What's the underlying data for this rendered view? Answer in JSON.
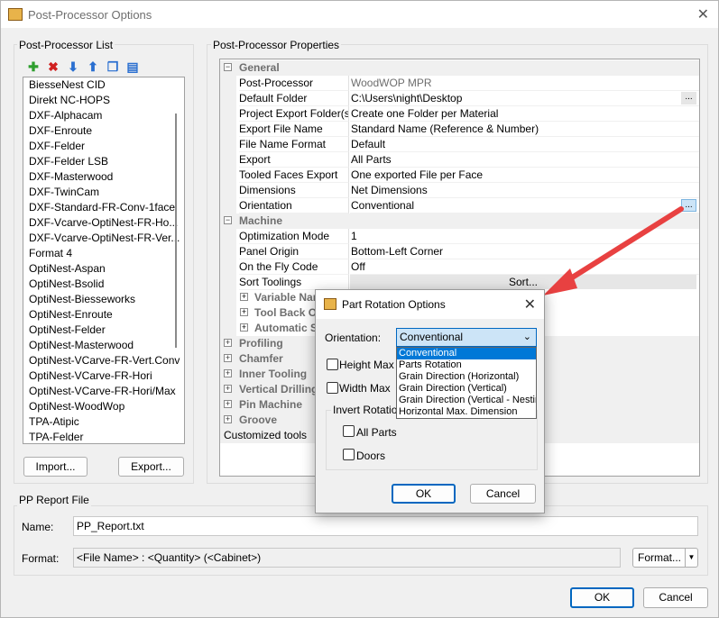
{
  "window": {
    "title": "Post-Processor Options",
    "close_glyph": "✕"
  },
  "left_panel": {
    "group_label": "Post-Processor List",
    "toolbar": [
      {
        "name": "add-icon",
        "glyph": "✚",
        "color": "#2e9e2e"
      },
      {
        "name": "delete-icon",
        "glyph": "✖",
        "color": "#d02020"
      },
      {
        "name": "move-down-icon",
        "glyph": "⬇",
        "color": "#2a6fd0"
      },
      {
        "name": "move-up-icon",
        "glyph": "⬆",
        "color": "#2a6fd0"
      },
      {
        "name": "copy-icon",
        "glyph": "❐",
        "color": "#2a6fd0"
      },
      {
        "name": "rename-icon",
        "glyph": "▤",
        "color": "#2a6fd0"
      }
    ],
    "items": [
      "BiesseNest CID",
      "Direkt NC-HOPS",
      "DXF-Alphacam",
      "DXF-Enroute",
      "DXF-Felder",
      "DXF-Felder LSB",
      "DXF-Masterwood",
      "DXF-TwinCam",
      "DXF-Standard-FR-Conv-1face",
      "DXF-Vcarve-OptiNest-FR-Ho...",
      "DXF-Vcarve-OptiNest-FR-Ver...",
      "Format 4",
      "OptiNest-Aspan",
      "OptiNest-Bsolid",
      "OptiNest-Biesseworks",
      "OptiNest-Enroute",
      "OptiNest-Felder",
      "OptiNest-Masterwood",
      "OptiNest-VCarve-FR-Vert.Conv",
      "OptiNest-VCarve-FR-Hori",
      "OptiNest-VCarve-FR-Hori/Max",
      "OptiNest-WoodWop",
      "TPA-Atipic",
      "TPA-Felder"
    ],
    "import_label": "Import...",
    "export_label": "Export..."
  },
  "properties": {
    "group_label": "Post-Processor Properties",
    "general": {
      "label": "General",
      "rows": [
        {
          "name": "Post-Processor",
          "value": "WoodWOP MPR",
          "gray": true
        },
        {
          "name": "Default Folder",
          "value": "C:\\Users\\night\\Desktop",
          "ellipsis": "..."
        },
        {
          "name": "Project Export Folder(s)",
          "value": "Create one Folder per Material"
        },
        {
          "name": "Export File Name",
          "value": "Standard Name (Reference & Number)"
        },
        {
          "name": "File Name Format",
          "value": "Default"
        },
        {
          "name": "Export",
          "value": "All Parts"
        },
        {
          "name": "Tooled Faces Export",
          "value": "One exported File per Face"
        },
        {
          "name": "Dimensions",
          "value": "Net Dimensions"
        },
        {
          "name": "Orientation",
          "value": "Conventional",
          "ellipsis": "..."
        }
      ]
    },
    "machine": {
      "label": "Machine",
      "rows": [
        {
          "name": "Optimization Mode",
          "value": "1"
        },
        {
          "name": "Panel Origin",
          "value": "Bottom-Left Corner"
        },
        {
          "name": "On the Fly Code",
          "value": "Off"
        }
      ],
      "sort_row": {
        "name": "Sort Toolings",
        "button": "Sort..."
      },
      "subgroups": [
        "Variable Nam",
        "Tool Back Of",
        "Automatic S"
      ]
    },
    "categories": [
      "Profiling",
      "Chamfer",
      "Inner Tooling",
      "Vertical Drilling",
      "Pin Machine",
      "Groove"
    ],
    "customized_tools": "Customized tools",
    "expand_glyph": "+",
    "collapse_glyph": "−"
  },
  "report": {
    "group_label": "PP Report File",
    "name_label": "Name:",
    "name_value": "PP_Report.txt",
    "format_label": "Format:",
    "format_value": "<File Name> : <Quantity> (<Cabinet>)",
    "format_button": "Format...",
    "dropdown_glyph": "▼"
  },
  "footer": {
    "ok_label": "OK",
    "cancel_label": "Cancel"
  },
  "dialog": {
    "title": "Part Rotation Options",
    "close_glyph": "✕",
    "orientation_label": "Orientation:",
    "orientation_value": "Conventional",
    "combo_arrow": "⌄",
    "options": [
      "Conventional",
      "Parts Rotation",
      "Grain Direction (Horizontal)",
      "Grain Direction (Vertical)",
      "Grain Direction (Vertical - Nestin",
      "Horizontal Max. Dimension"
    ],
    "height_max_label": "Height Max",
    "width_max_label": "Width Max",
    "invert_rotation_label": "Invert Rotation",
    "all_parts_label": "All Parts",
    "doors_label": "Doors",
    "ok_label": "OK",
    "cancel_label": "Cancel"
  },
  "annotation": {
    "arrow_color": "#e84141"
  }
}
